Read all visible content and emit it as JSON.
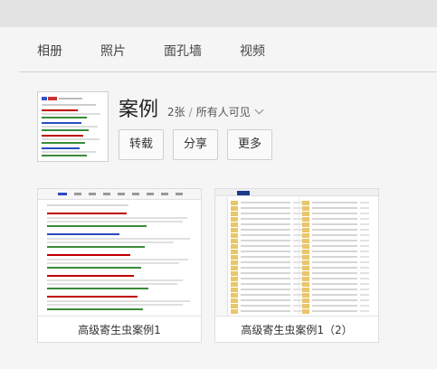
{
  "tabs": [
    "相册",
    "照片",
    "面孔墙",
    "视频"
  ],
  "album": {
    "title": "案例",
    "count": "2张",
    "separator": "/",
    "visibility": "所有人可见"
  },
  "actions": {
    "repost": "转载",
    "share": "分享",
    "more": "更多"
  },
  "photos": [
    {
      "caption": "高级寄生虫案例1"
    },
    {
      "caption": "高级寄生虫案例1（2）"
    }
  ],
  "colors": {
    "topbar": "#e3e3e3",
    "link_red": "#c00000",
    "snippet_green": "#3a8a3a",
    "link_blue": "#2a4bbf",
    "folder": "#e8c66a"
  }
}
